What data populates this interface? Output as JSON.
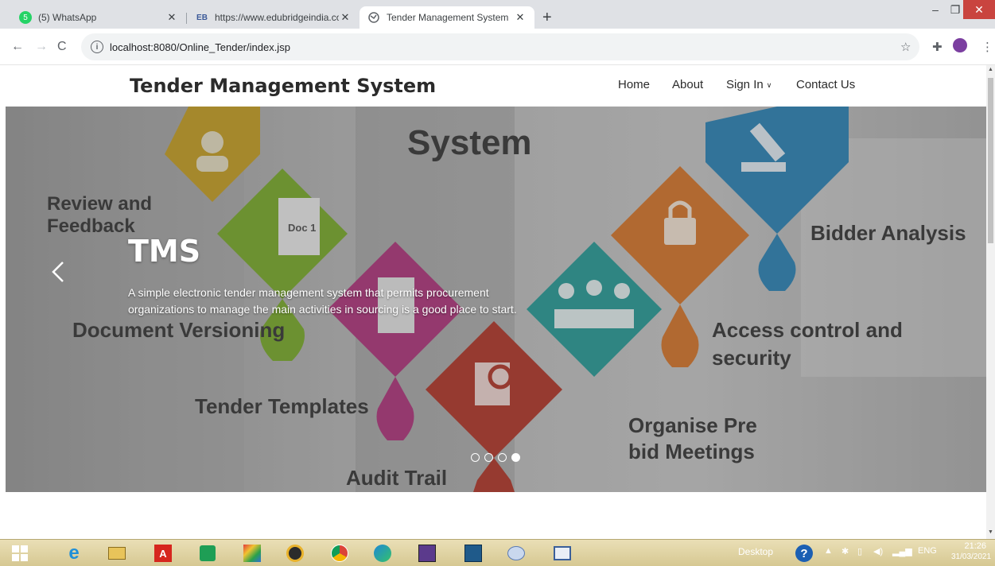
{
  "browser": {
    "tabs": [
      {
        "title": "(5) WhatsApp",
        "favicon": "whatsapp-icon"
      },
      {
        "title": "https://www.edubridgeindia.com",
        "favicon": "edubridge-icon"
      },
      {
        "title": "Tender Management System",
        "favicon": "globe-icon",
        "active": true
      }
    ],
    "url": "localhost:8080/Online_Tender/index.jsp"
  },
  "header": {
    "brand": "Tender Management System",
    "nav": [
      "Home",
      "About",
      "Sign In",
      "Contact Us"
    ]
  },
  "hero": {
    "image_texts": [
      "System",
      "Review and",
      "Feedback",
      "Doc 1",
      "Bidder Analysis",
      "Document Versioning",
      "Access control and",
      "security",
      "Tender Templates",
      "Organise Pre",
      "bid Meetings",
      "Audit Trail"
    ],
    "caption_title": "TMS",
    "caption_text": "A simple electronic tender management system that permits procurement organizations to manage the main activities in sourcing is a good place to start.",
    "slide_count": 4,
    "active_slide": 4
  },
  "taskbar": {
    "toolbar_label": "Desktop",
    "language": "ENG",
    "time": "21:26",
    "date": "31/03/2021"
  },
  "colors": {
    "yellow": "#c9a227",
    "green": "#7cae2e",
    "magenta": "#b2387f",
    "red": "#b43a2c",
    "teal": "#2b9e9a",
    "orange": "#d9792e",
    "blue": "#2f86b8"
  }
}
